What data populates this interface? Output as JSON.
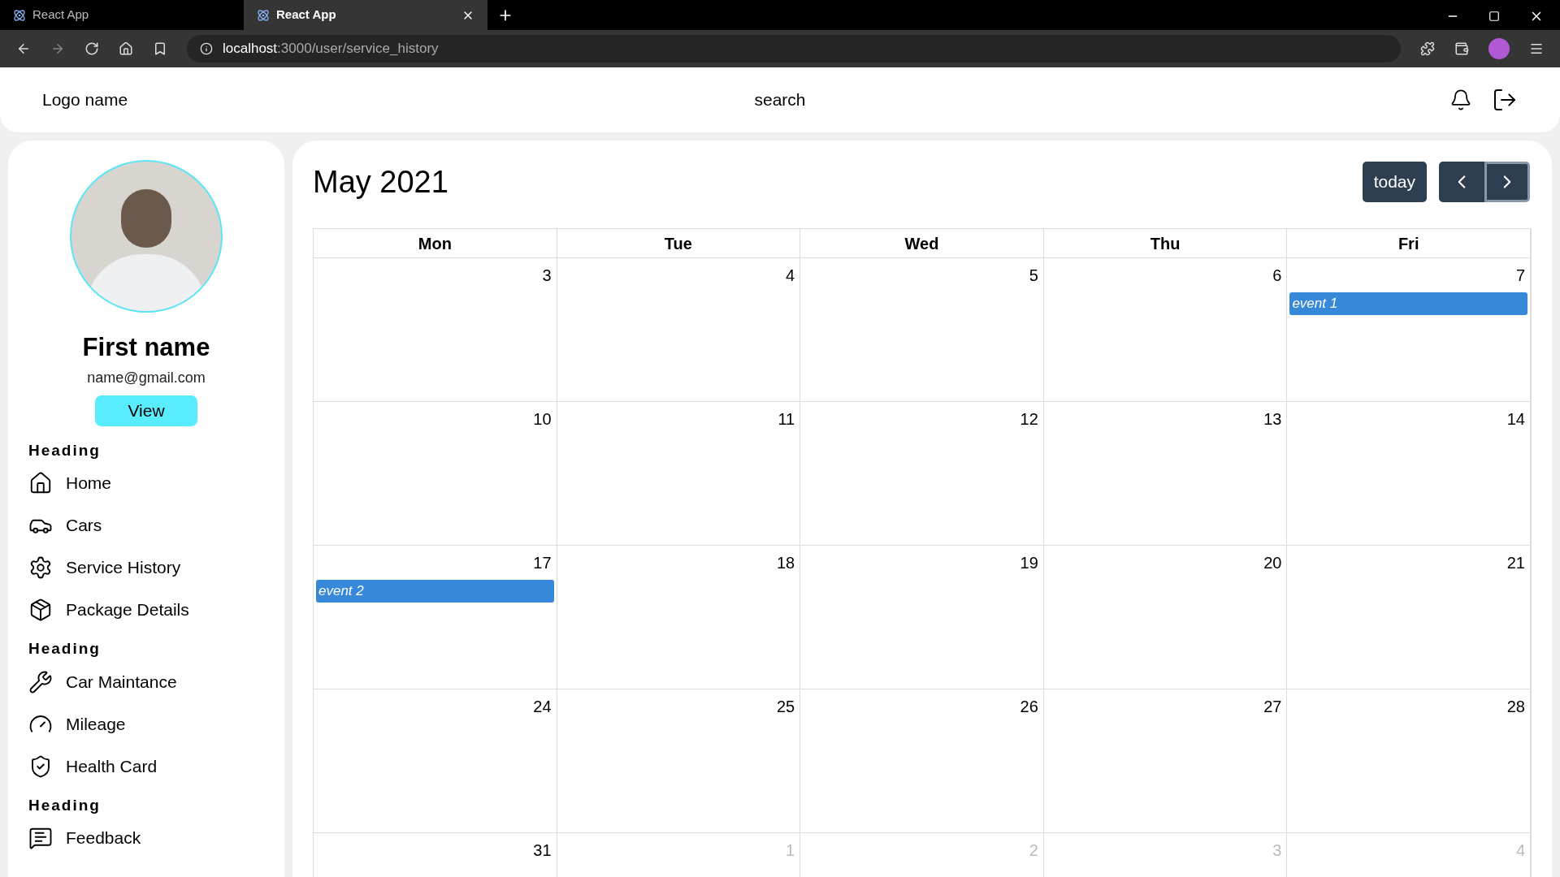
{
  "browser": {
    "tabs": [
      {
        "title": "React App",
        "selected": false
      },
      {
        "title": "React App",
        "selected": true
      }
    ],
    "address": {
      "host": "localhost",
      "path": ":3000/user/service_history"
    }
  },
  "header": {
    "logo": "Logo name",
    "search": "search"
  },
  "sidebar": {
    "name": "First name",
    "email": "name@gmail.com",
    "view_button": "View",
    "sections": [
      {
        "heading": "Heading",
        "items": [
          "Home",
          "Cars",
          "Service History",
          "Package Details"
        ]
      },
      {
        "heading": "Heading",
        "items": [
          "Car Maintance",
          "Mileage",
          "Health Card"
        ]
      },
      {
        "heading": "Heading",
        "items": [
          "Feedback"
        ]
      }
    ]
  },
  "calendar": {
    "title": "May 2021",
    "today_button": "today",
    "columns": [
      "Mon",
      "Tue",
      "Wed",
      "Thu",
      "Fri"
    ],
    "weeks": [
      [
        {
          "day": "3",
          "other_month": false
        },
        {
          "day": "4",
          "other_month": false
        },
        {
          "day": "5",
          "other_month": false
        },
        {
          "day": "6",
          "other_month": false
        },
        {
          "day": "7",
          "other_month": false,
          "events": [
            "event 1"
          ]
        }
      ],
      [
        {
          "day": "10",
          "other_month": false
        },
        {
          "day": "11",
          "other_month": false
        },
        {
          "day": "12",
          "other_month": false
        },
        {
          "day": "13",
          "other_month": false
        },
        {
          "day": "14",
          "other_month": false
        }
      ],
      [
        {
          "day": "17",
          "other_month": false,
          "events": [
            "event 2"
          ]
        },
        {
          "day": "18",
          "other_month": false
        },
        {
          "day": "19",
          "other_month": false
        },
        {
          "day": "20",
          "other_month": false
        },
        {
          "day": "21",
          "other_month": false
        }
      ],
      [
        {
          "day": "24",
          "other_month": false
        },
        {
          "day": "25",
          "other_month": false
        },
        {
          "day": "26",
          "other_month": false
        },
        {
          "day": "27",
          "other_month": false
        },
        {
          "day": "28",
          "other_month": false
        }
      ],
      [
        {
          "day": "31",
          "other_month": false
        },
        {
          "day": "1",
          "other_month": true
        },
        {
          "day": "2",
          "other_month": true
        },
        {
          "day": "3",
          "other_month": true
        },
        {
          "day": "4",
          "other_month": true
        }
      ]
    ]
  }
}
